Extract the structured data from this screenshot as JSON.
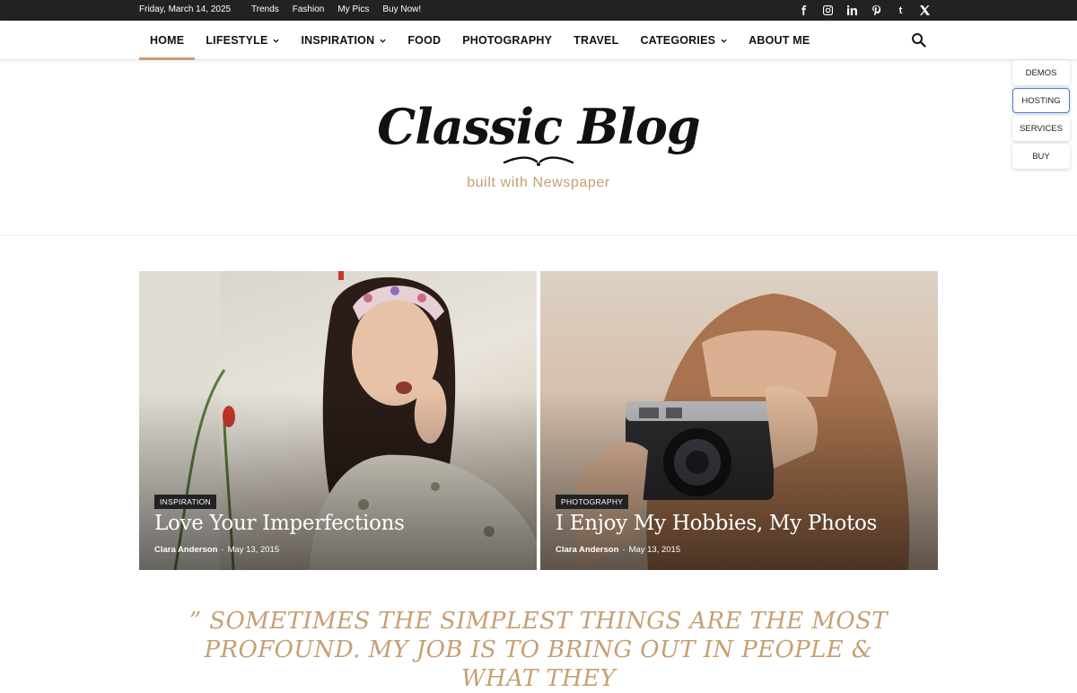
{
  "topbar": {
    "date": "Friday, March 14, 2025",
    "links": [
      "Trends",
      "Fashion",
      "My Pics",
      "Buy Now!"
    ],
    "social_icons": [
      "facebook-icon",
      "instagram-icon",
      "linkedin-icon",
      "pinterest-icon",
      "tumblr-icon",
      "x-icon"
    ]
  },
  "nav": {
    "items": [
      {
        "label": "HOME",
        "active": true,
        "dropdown": false
      },
      {
        "label": "LIFESTYLE",
        "active": false,
        "dropdown": true
      },
      {
        "label": "INSPIRATION",
        "active": false,
        "dropdown": true
      },
      {
        "label": "FOOD",
        "active": false,
        "dropdown": false
      },
      {
        "label": "PHOTOGRAPHY",
        "active": false,
        "dropdown": false
      },
      {
        "label": "TRAVEL",
        "active": false,
        "dropdown": false
      },
      {
        "label": "CATEGORIES",
        "active": false,
        "dropdown": true
      },
      {
        "label": "ABOUT ME",
        "active": false,
        "dropdown": false
      }
    ],
    "search_icon": "search-icon"
  },
  "float_buttons": [
    "DEMOS",
    "HOSTING",
    "SERVICES",
    "BUY"
  ],
  "logo": {
    "brand": "Classic Blog",
    "tagline": "built with Newspaper"
  },
  "posts": [
    {
      "category": "INSPIRATION",
      "title": "Love Your Imperfections",
      "author": "Clara Anderson",
      "date": "May 13, 2015"
    },
    {
      "category": "PHOTOGRAPHY",
      "title": "I Enjoy My Hobbies, My Photos",
      "author": "Clara Anderson",
      "date": "May 13, 2015"
    }
  ],
  "quote": "” SOMETIMES THE SIMPLEST THINGS ARE THE MOST PROFOUND. MY JOB IS TO BRING OUT IN PEOPLE & WHAT THEY",
  "colors": {
    "accent": "#c69f73",
    "topbar": "#222222"
  }
}
